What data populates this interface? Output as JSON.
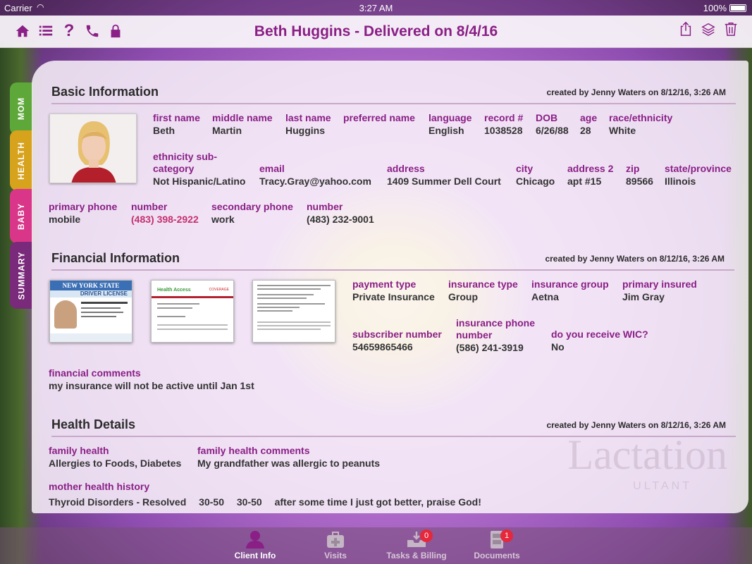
{
  "status_bar": {
    "carrier": "Carrier",
    "time": "3:27 AM",
    "battery": "100%"
  },
  "navbar": {
    "title": "Beth Huggins - Delivered on 8/4/16",
    "left_icons": [
      "home-icon",
      "list-icon",
      "help-icon",
      "phone-icon",
      "lock-icon"
    ],
    "right_icons": [
      "share-icon",
      "layers-icon",
      "trash-icon"
    ],
    "accent_color": "#8a1f86"
  },
  "side_tabs": [
    {
      "label": "MOM",
      "color": "#5ea83a"
    },
    {
      "label": "HEALTH",
      "color": "#d7a21c"
    },
    {
      "label": "BABY",
      "color": "#d9368a"
    },
    {
      "label": "SUMMARY",
      "color": "#7a2a7a"
    }
  ],
  "basic": {
    "title": "Basic Information",
    "created": "created by Jenny Waters on 8/12/16, 3:26 AM",
    "first_name_label": "first name",
    "first_name": "Beth",
    "middle_name_label": "middle name",
    "middle_name": "Martin",
    "last_name_label": "last name",
    "last_name": "Huggins",
    "preferred_name_label": "preferred name",
    "preferred_name": "",
    "language_label": "language",
    "language": "English",
    "record_label": "record #",
    "record": "1038528",
    "dob_label": "DOB",
    "dob": "6/26/88",
    "age_label": "age",
    "age": "28",
    "race_label": "race/ethnicity",
    "race": "White",
    "ethnicity_label": "ethnicity sub-category",
    "ethnicity": "Not Hispanic/Latino",
    "email_label": "email",
    "email": "Tracy.Gray@yahoo.com",
    "address_label": "address",
    "address": "1409 Summer Dell Court",
    "city_label": "city",
    "city": "Chicago",
    "address2_label": "address 2",
    "address2": "apt #15",
    "zip_label": "zip",
    "zip": "89566",
    "state_label": "state/province",
    "state": "Illinois",
    "primary_phone_label": "primary phone",
    "primary_phone": "mobile",
    "number1_label": "number",
    "number1": "(483) 398-2922",
    "secondary_phone_label": "secondary phone",
    "secondary_phone": "work",
    "number2_label": "number",
    "number2": "(483) 232-9001"
  },
  "financial": {
    "title": "Financial Information",
    "created": "created by Jenny Waters on 8/12/16, 3:26 AM",
    "card1_state": "NEW YORK STATE",
    "card1_type": "DRIVER LICENSE",
    "card2_brand": "Health Access",
    "card2_label": "COVERAGE",
    "payment_type_label": "payment type",
    "payment_type": "Private Insurance",
    "insurance_type_label": "insurance type",
    "insurance_type": "Group",
    "insurance_group_label": "insurance group",
    "insurance_group": "Aetna",
    "primary_insured_label": "primary insured",
    "primary_insured": "Jim Gray",
    "subscriber_label": "subscriber number",
    "subscriber": "54659865466",
    "insurance_phone_label": "insurance phone number",
    "insurance_phone": "(586) 241-3919",
    "wic_label": "do you receive WIC?",
    "wic": "No",
    "comments_label": "financial comments",
    "comments": "my insurance will not be active until Jan 1st"
  },
  "health": {
    "title": "Health Details",
    "created": "created by Jenny Waters on 8/12/16, 3:26 AM",
    "family_health_label": "family health",
    "family_health": "Allergies to Foods, Diabetes",
    "family_comments_label": "family health comments",
    "family_comments": "My grandfather was allergic to peanuts",
    "mother_history_label": "mother health history",
    "mother_history_row": [
      "Thyroid Disorders -  Resolved",
      "30-50",
      "30-50",
      "after some time I just got better, praise God!"
    ]
  },
  "watermark": {
    "text": "Lactation",
    "sub": "ULTANT"
  },
  "tab_bar": [
    {
      "label": "Client Info",
      "badge": ""
    },
    {
      "label": "Visits",
      "badge": ""
    },
    {
      "label": "Tasks & Billing",
      "badge": "0"
    },
    {
      "label": "Documents",
      "badge": "1"
    }
  ]
}
